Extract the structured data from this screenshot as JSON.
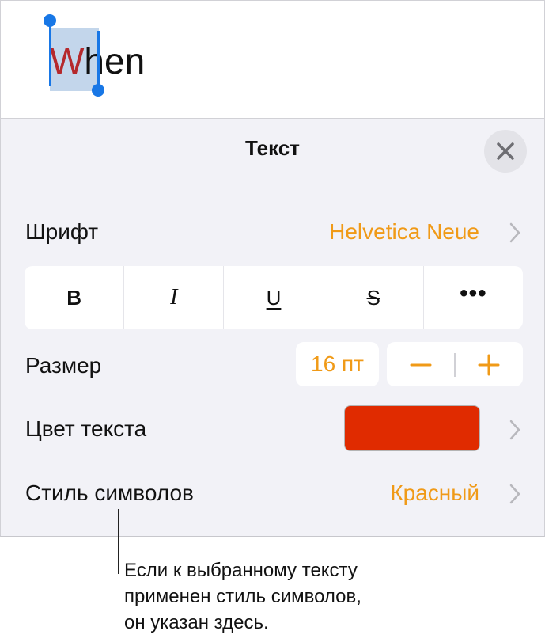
{
  "document": {
    "word_first_letter": "W",
    "word_rest": "hen"
  },
  "panel": {
    "title": "Текст",
    "font_label": "Шрифт",
    "font_value": "Helvetica Neue",
    "style_buttons": [
      "B",
      "I",
      "U",
      "S",
      "•••"
    ],
    "size_label": "Размер",
    "size_value": "16 пт",
    "text_color_label": "Цвет текста",
    "text_color": "#e02b00",
    "char_style_label": "Стиль символов",
    "char_style_value": "Красный"
  },
  "colors": {
    "accent": "#f09a17",
    "selection": "#1877e6"
  },
  "icons": [
    "close-icon",
    "chevron-right-icon",
    "minus-icon",
    "plus-icon"
  ],
  "callout": "Если к выбранному тексту\nприменен стиль символов,\nон указан здесь."
}
